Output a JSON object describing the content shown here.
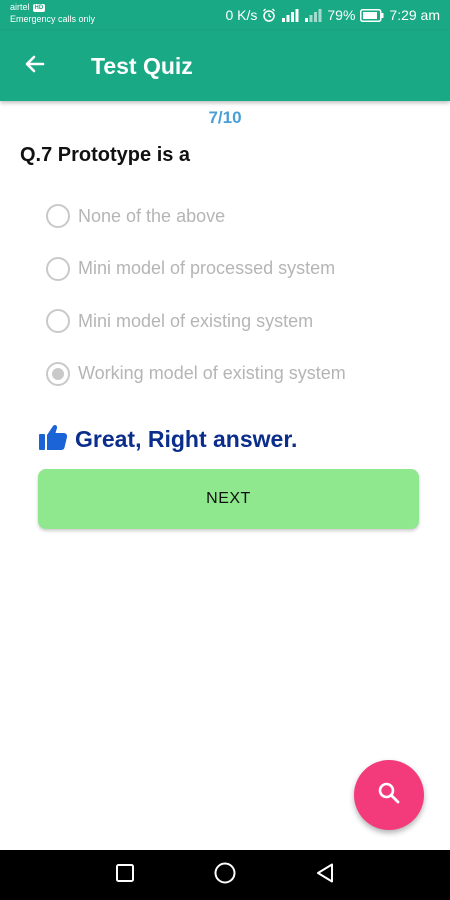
{
  "status_bar": {
    "carrier": "airtel",
    "carrier_badge": "HD",
    "emergency": "Emergency calls only",
    "speed": "0 K/s",
    "battery": "79%",
    "time": "7:29 am"
  },
  "app_bar": {
    "title": "Test Quiz",
    "color": "#1aa985"
  },
  "quiz": {
    "progress": "7/10",
    "question": "Q.7 Prototype is a",
    "options": [
      {
        "label": "None of the above",
        "selected": false
      },
      {
        "label": "Mini model of processed system",
        "selected": false
      },
      {
        "label": "Mini model of existing system",
        "selected": false
      },
      {
        "label": "Working model of existing system",
        "selected": true
      }
    ],
    "feedback": "Great, Right answer.",
    "next_label": "NEXT"
  },
  "fab": {
    "icon": "search-icon",
    "color": "#f33b7b"
  },
  "nav_bar": {
    "icons": [
      "recents-icon",
      "home-icon",
      "back-icon"
    ]
  }
}
